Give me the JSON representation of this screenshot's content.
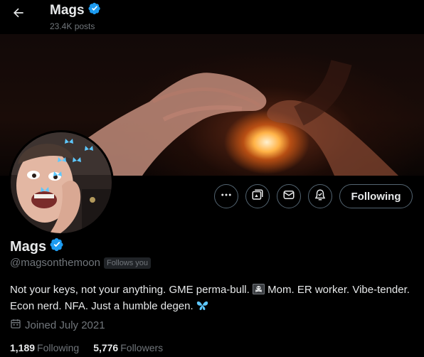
{
  "header": {
    "title": "Mags",
    "posts_count": "23.4K posts",
    "back_icon": "arrow-left-icon"
  },
  "profile": {
    "display_name": "Mags",
    "handle": "@magsonthemoon",
    "follows_you": "Follows you",
    "verified": true,
    "bio_part1": "Not your keys, not your anything. GME perma-bull. ",
    "bio_emoji1": "pirate-flag-icon",
    "bio_part2": " Mom. ER worker. Vibe-tender. Econ nerd. NFA. Just a humble degen. ",
    "bio_emoji2": "butterfly-icon",
    "joined": "Joined July 2021"
  },
  "stats": {
    "following_count": "1,189",
    "following_label": "Following",
    "followers_count": "5,776",
    "followers_label": "Followers"
  },
  "actions": {
    "more_icon": "more-icon",
    "grok_icon": "grok-icon",
    "message_icon": "message-icon",
    "notify_icon": "bell-icon",
    "following_label": "Following"
  },
  "colors": {
    "background": "#000000",
    "text_primary": "#e7e9ea",
    "text_secondary": "#71767b",
    "border": "#536471",
    "verified": "#1d9bf0"
  }
}
